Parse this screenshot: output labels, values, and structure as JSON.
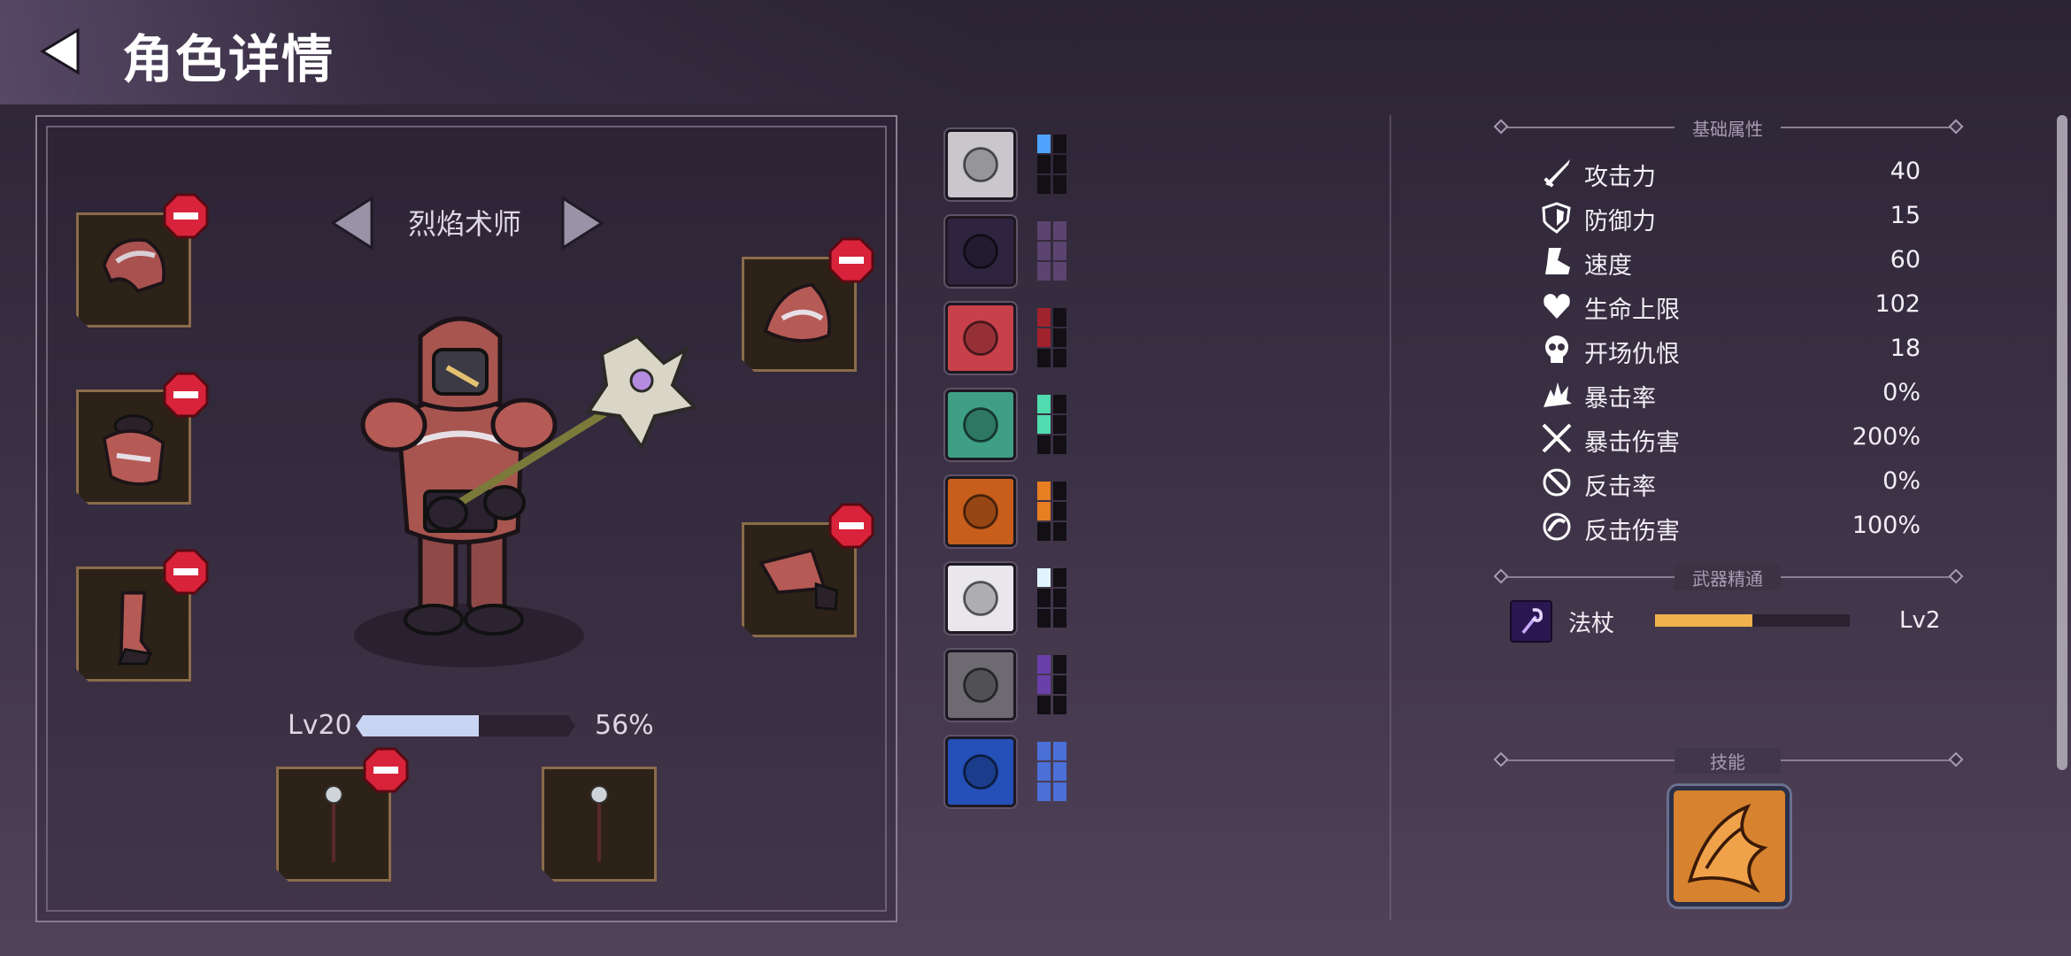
{
  "header": {
    "title": "角色详情"
  },
  "character": {
    "class_name": "烈焰术师",
    "level": "Lv20",
    "xp_percent": "56%",
    "xp_fraction": 0.56
  },
  "gems": [
    {
      "icon": "skull-crossbones-gem-icon",
      "color": "#4fa3ff",
      "filled": 1
    },
    {
      "icon": "shadow-figure-gem-icon",
      "color": "#5b4470",
      "filled": 0
    },
    {
      "icon": "sword-gem-icon",
      "color": "#a0222c",
      "filled": 2
    },
    {
      "icon": "goblin-face-gem-icon",
      "color": "#4fdcae",
      "filled": 2
    },
    {
      "icon": "zombie-hand-gem-icon",
      "color": "#e67e22",
      "filled": 2
    },
    {
      "icon": "angel-wings-gem-icon",
      "color": "#dff4ff",
      "filled": 1
    },
    {
      "icon": "coins-gem-icon",
      "color": "#6b3fa8",
      "filled": 2
    },
    {
      "icon": "gold-gauntlet-gem-icon",
      "color": "#4a6fd6",
      "filled": 3
    }
  ],
  "sections": {
    "basic": "基础属性",
    "mastery": "武器精通",
    "skills": "技能"
  },
  "stats": [
    {
      "name": "攻击力",
      "value": "40",
      "icon": "sword-icon"
    },
    {
      "name": "防御力",
      "value": "15",
      "icon": "shield-icon"
    },
    {
      "name": "速度",
      "value": "60",
      "icon": "boot-icon"
    },
    {
      "name": "生命上限",
      "value": "102",
      "icon": "heart-icon"
    },
    {
      "name": "开场仇恨",
      "value": "18",
      "icon": "skull-icon"
    },
    {
      "name": "暴击率",
      "value": "0%",
      "icon": "crit-burst-icon"
    },
    {
      "name": "暴击伤害",
      "value": "200%",
      "icon": "crossed-swords-icon"
    },
    {
      "name": "反击率",
      "value": "0%",
      "icon": "counter-icon"
    },
    {
      "name": "反击伤害",
      "value": "100%",
      "icon": "counter-damage-icon"
    }
  ],
  "mastery": {
    "name": "法杖",
    "level": "Lv2",
    "progress": 0.5
  },
  "colors": {
    "accent_bar": "#f0b24c",
    "xp_bar": "#c9d3f2",
    "remove": "#d8233a"
  }
}
